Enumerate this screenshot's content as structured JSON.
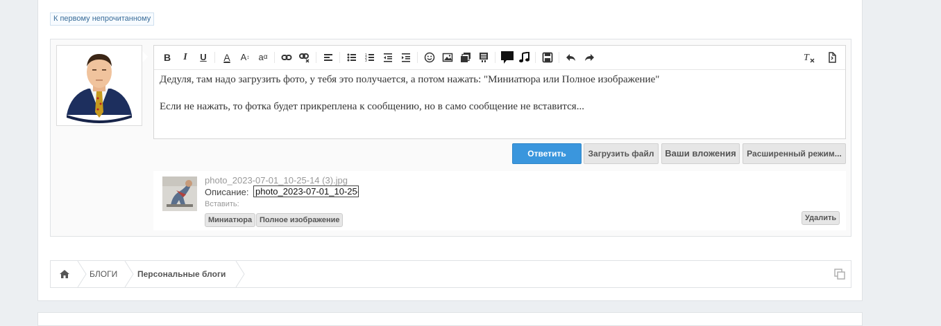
{
  "page": {
    "first_unread_link": "К первому непрочитанному"
  },
  "editor": {
    "toolbar": {
      "bold": "B",
      "italic": "I",
      "underline": "U",
      "font_color": "A",
      "font_size": "A",
      "font_family": "a"
    },
    "body": {
      "line1": " Дедуля, там надо загрузить фото, у тебя это получается, а потом нажать: \"Миниатюра или Полное изображение\"",
      "line2": "Если не нажать, то фотка будет прикреплена к сообщению, но в само сообщение не вставится..."
    }
  },
  "actions": {
    "reply": "Ответить",
    "upload": "Загрузить файл",
    "attachments": "Ваши вложения",
    "advanced": "Расширенный режим..."
  },
  "attachment": {
    "file_name": "photo_2023-07-01_10-25-14 (3).jpg",
    "description_label": "Описание:",
    "description_value": "photo_2023-07-01_10-25-",
    "insert_label": "Вставить:",
    "thumbnail_btn": "Миниатюра",
    "full_image_btn": "Полное изображение",
    "delete_btn": "Удалить"
  },
  "breadcrumb": {
    "items": [
      "БЛОГИ",
      "Персональные блоги"
    ]
  }
}
